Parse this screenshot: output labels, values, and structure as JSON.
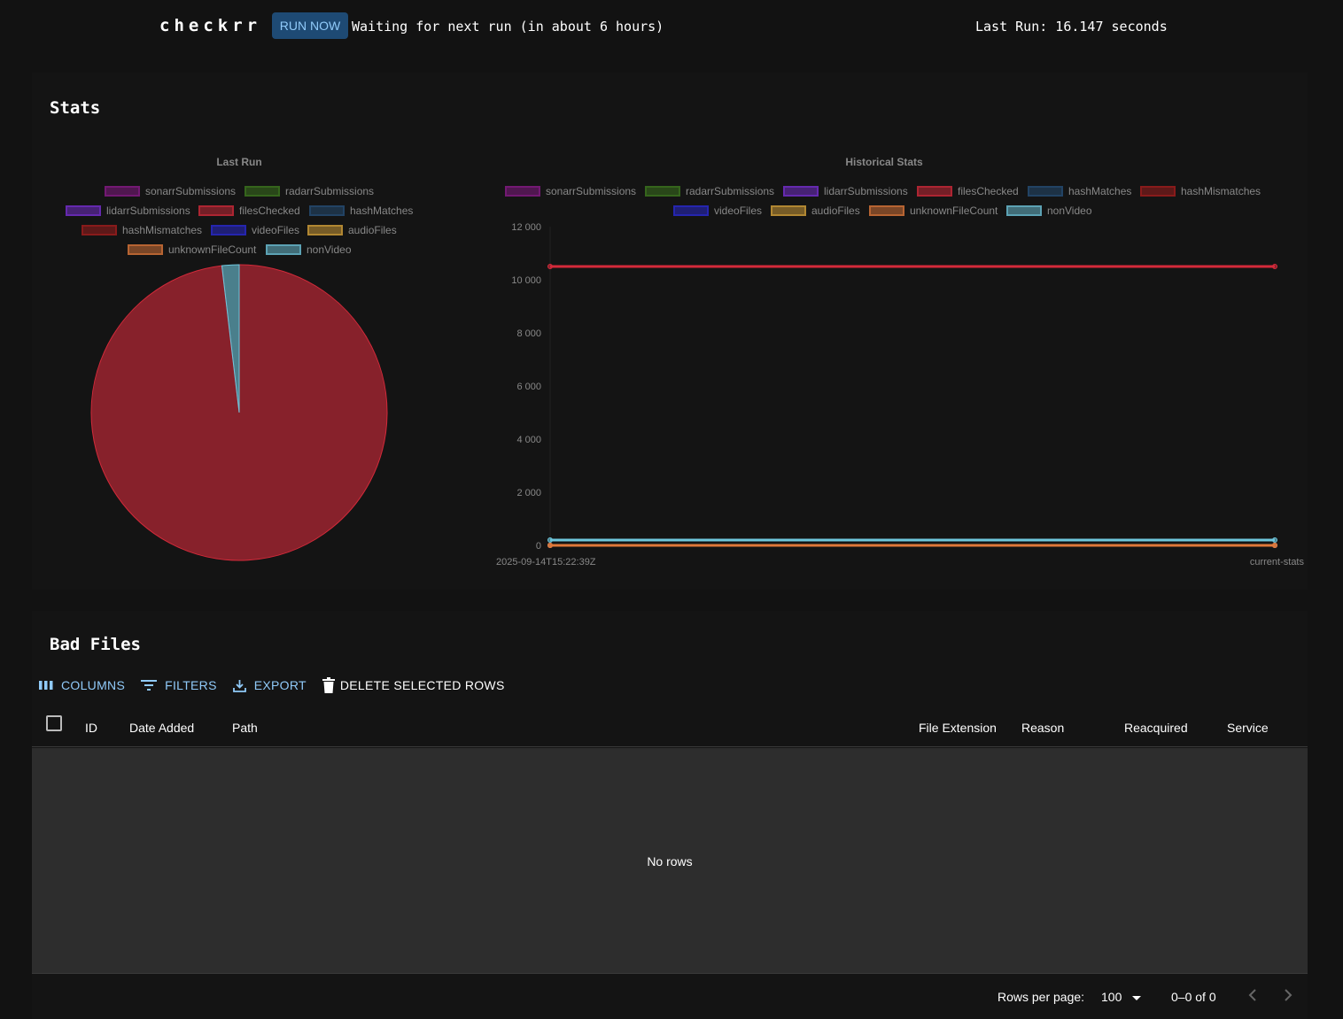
{
  "header": {
    "app_name": "checkrr",
    "run_button": "RUN NOW",
    "status": "Waiting for next run (in about 6 hours)",
    "last_run": "Last Run: 16.147 seconds",
    "accent_color": "#1e4a74"
  },
  "stats": {
    "title": "Stats",
    "last_run_chart": {
      "title": "Last Run"
    },
    "historical_chart": {
      "title": "Historical Stats"
    },
    "legend": [
      {
        "name": "sonarrSubmissions",
        "color": "#8b1a8b"
      },
      {
        "name": "radarrSubmissions",
        "color": "#3d7a1e"
      },
      {
        "name": "lidarrSubmissions",
        "color": "#7a2fd6"
      },
      {
        "name": "filesChecked",
        "color": "#d42a3a"
      },
      {
        "name": "hashMatches",
        "color": "#264f78"
      },
      {
        "name": "hashMismatches",
        "color": "#a61d1d"
      },
      {
        "name": "videoFiles",
        "color": "#2a2ad6"
      },
      {
        "name": "audioFiles",
        "color": "#d9a33a"
      },
      {
        "name": "unknownFileCount",
        "color": "#e0783a"
      },
      {
        "name": "nonVideo",
        "color": "#6ec6dc"
      }
    ]
  },
  "chart_data": [
    {
      "type": "pie",
      "title": "Last Run",
      "labels": [
        "sonarrSubmissions",
        "radarrSubmissions",
        "lidarrSubmissions",
        "filesChecked",
        "hashMatches",
        "hashMismatches",
        "videoFiles",
        "audioFiles",
        "unknownFileCount",
        "nonVideo"
      ],
      "values": [
        0,
        0,
        0,
        10500,
        0,
        0,
        0,
        0,
        0,
        200
      ],
      "legend": "top"
    },
    {
      "type": "line",
      "title": "Historical Stats",
      "x": [
        "2025-09-14T15:22:39Z",
        "current-stats"
      ],
      "ylim": [
        0,
        12000
      ],
      "yticks": [
        "0",
        "2 000",
        "4 000",
        "6 000",
        "8 000",
        "10 000",
        "12 000"
      ],
      "yticks_values": [
        0,
        2000,
        4000,
        6000,
        8000,
        10000,
        12000
      ],
      "series": [
        {
          "name": "sonarrSubmissions",
          "values": [
            0,
            0
          ]
        },
        {
          "name": "radarrSubmissions",
          "values": [
            0,
            0
          ]
        },
        {
          "name": "lidarrSubmissions",
          "values": [
            0,
            0
          ]
        },
        {
          "name": "filesChecked",
          "values": [
            10500,
            10500
          ]
        },
        {
          "name": "hashMatches",
          "values": [
            0,
            0
          ]
        },
        {
          "name": "hashMismatches",
          "values": [
            0,
            0
          ]
        },
        {
          "name": "videoFiles",
          "values": [
            0,
            0
          ]
        },
        {
          "name": "audioFiles",
          "values": [
            0,
            0
          ]
        },
        {
          "name": "unknownFileCount",
          "values": [
            0,
            0
          ]
        },
        {
          "name": "nonVideo",
          "values": [
            200,
            200
          ]
        }
      ],
      "grid": false,
      "legend": "top"
    }
  ],
  "bad_files": {
    "title": "Bad Files",
    "toolbar": {
      "columns": "COLUMNS",
      "filters": "FILTERS",
      "export": "EXPORT",
      "delete": "DELETE SELECTED ROWS"
    },
    "columns": [
      "ID",
      "Date Added",
      "Path",
      "File Extension",
      "Reason",
      "Reacquired",
      "Service"
    ],
    "empty_text": "No rows",
    "footer": {
      "rows_per_page_label": "Rows per page:",
      "rows_per_page_value": "100",
      "range": "0–0 of 0"
    }
  }
}
